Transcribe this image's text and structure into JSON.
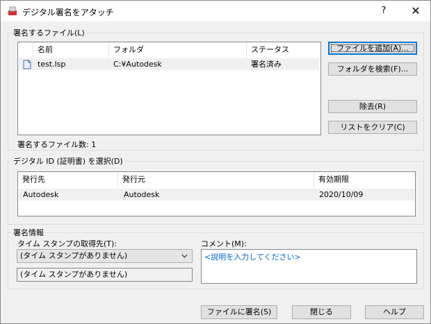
{
  "window": {
    "title": "デジタル署名をアタッチ",
    "help_label": "?",
    "close_label": "✕"
  },
  "files_group": {
    "legend": "署名するファイル(L)",
    "columns": [
      "名前",
      "フォルダ",
      "ステータス"
    ],
    "rows": [
      {
        "name": "test.lsp",
        "folder": "C:¥Autodesk",
        "status": "署名済み",
        "icon": "file-icon"
      }
    ],
    "count_label": "署名するファイル数: 1",
    "buttons": {
      "add": "ファイルを追加(A)...",
      "search_folder": "フォルダを検索(F)...",
      "remove": "除去(R)",
      "clear": "リストをクリア(C)"
    }
  },
  "cert_group": {
    "legend": "デジタル ID (証明書) を選択(D)",
    "columns": [
      "発行先",
      "発行元",
      "有効期限"
    ],
    "rows": [
      {
        "issued_to": "Autodesk",
        "issued_by": "Autodesk",
        "expires": "2020/10/09"
      }
    ]
  },
  "sign_info": {
    "legend": "署名情報",
    "timestamp_label": "タイム スタンプの取得先(T):",
    "timestamp_selected": "(タイム スタンプがありません)",
    "timestamp_readonly": "(タイム スタンプがありません)",
    "comment_label": "コメント(M):",
    "comment_placeholder": "<説明を入力してください>"
  },
  "footer": {
    "sign_button": "ファイルに署名(S)",
    "close_button": "閉じる",
    "help_button": "ヘルプ"
  },
  "colors": {
    "accent": "#0078d7",
    "comment_text": "#0066cc",
    "app_icon": "#d62d2d"
  }
}
